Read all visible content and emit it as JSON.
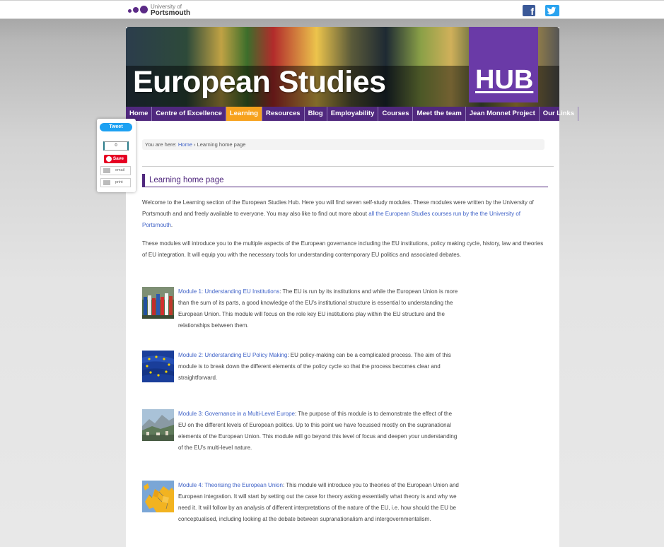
{
  "topbar": {
    "logo_small": "University of",
    "logo_big": "Portsmouth",
    "social": [
      "facebook-icon",
      "twitter-icon"
    ],
    "facebook_glyph": "f"
  },
  "banner": {
    "title": "European Studies",
    "hub": "HUB"
  },
  "nav": [
    {
      "label": "Home",
      "active": false
    },
    {
      "label": "Centre of Excellence",
      "active": false
    },
    {
      "label": "Learning",
      "active": true
    },
    {
      "label": "Resources",
      "active": false
    },
    {
      "label": "Blog",
      "active": false
    },
    {
      "label": "Employability",
      "active": false
    },
    {
      "label": "Courses",
      "active": false
    },
    {
      "label": "Meet the team",
      "active": false
    },
    {
      "label": "Jean Monnet Project",
      "active": false
    },
    {
      "label": "Our Links",
      "active": false
    }
  ],
  "share": {
    "tweet": "Tweet",
    "count": "0",
    "save": "Save",
    "email": "email",
    "print": "print"
  },
  "breadcrumb": {
    "prefix": "You are here:",
    "home": "Home",
    "separator": "›",
    "current": "Learning home page"
  },
  "page_title": "Learning home page",
  "intro": {
    "p1_text": "Welcome to the Learning section of the European Studies Hub.  Here you will find seven self-study modules.  These modules were written by the University of Portsmouth and and freely available to everyone. You may also like to find out more about ",
    "p1_link": "all the European Studies courses run by the the University of Portsmouth",
    "p1_end": ".",
    "p2": "These modules will introduce you to the multiple aspects of the European governance including the EU institutions, policy making cycle, history, law and theories of EU integration. It will equip you with the necessary tools for understanding contemporary EU politics and associated debates."
  },
  "modules": [
    {
      "link": "Module 1: Understanding EU Institutions",
      "text": ": The EU is run by its institutions and while the European Union is more than the sum of its parts, a good knowledge of the EU's institutional structure is essential to understanding the European Union. This module will focus on the role key EU institutions play within the EU structure and the relationships between them.",
      "thumb": "flags-thumbnail"
    },
    {
      "link": "Module 2: Understanding EU Policy Making",
      "text": ": EU policy-making can be a complicated process. The aim of this module is to break down the different elements of the policy cycle so that the process becomes clear and straightforward.",
      "thumb": "eu-flag-thumbnail"
    },
    {
      "link": "Module 3: Governance in a Multi-Level Europe",
      "text": ": The purpose of this module is to demonstrate the effect of the EU on the different levels of European politics. Up to this point we have focussed mostly on the supranational elements of the European Union. This module will go beyond this level of focus and deepen your understanding of the EU's multi-level nature.",
      "thumb": "landscape-thumbnail"
    },
    {
      "link": "Module 4: Theorising the European Union",
      "text": ": This module will introduce you to theories of the European Union and European integration. It will start by setting out the case for theory asking essentially what theory is and why we need it. It will follow by an analysis of different interpretations of the nature of the EU, i.e. how should the EU be conceptualised, including looking at the debate between supranationalism and intergovernmentalism.",
      "thumb": "map-thumbnail"
    }
  ],
  "colors": {
    "purple": "#50287e",
    "active_tab": "#f7a21d",
    "link": "#3f62c7"
  }
}
